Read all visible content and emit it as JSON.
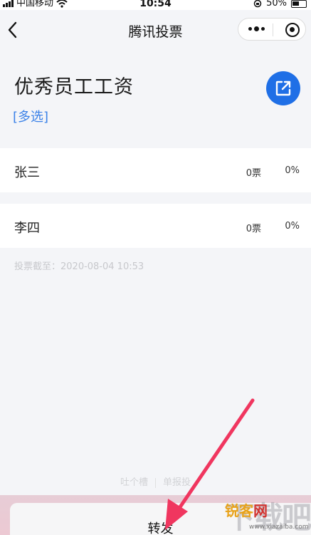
{
  "status_bar": {
    "carrier": "中国移动",
    "time": "10:54",
    "battery": "50%"
  },
  "nav": {
    "title": "腾讯投票"
  },
  "vote": {
    "title": "优秀员工工资",
    "type": "[多选]",
    "options": [
      {
        "name": "张三",
        "votes": "0票",
        "percent": "0%",
        "percent_value": 0
      },
      {
        "name": "李四",
        "votes": "0票",
        "percent": "0%",
        "percent_value": 0
      }
    ],
    "deadline": "投票截至：2020-08-04 10:53"
  },
  "footer": {
    "link1": "吐个槽",
    "link2": "单报投"
  },
  "sheet": {
    "forward_label": "转发"
  },
  "watermark": {
    "big_text": "下载吧",
    "brand1": "锐客",
    "brand2": "网",
    "url": "www.xiazaiba.com"
  },
  "colors": {
    "accent_blue": "#1f6fe6",
    "type_blue": "#3b82e8",
    "arrow_pink": "#f0365f"
  },
  "icons": {
    "back": "chevron-left-icon",
    "more": "more-dots-icon",
    "close": "target-close-icon",
    "share": "share-external-icon",
    "wifi": "wifi-icon",
    "signal": "signal-icon",
    "battery": "battery-icon"
  }
}
